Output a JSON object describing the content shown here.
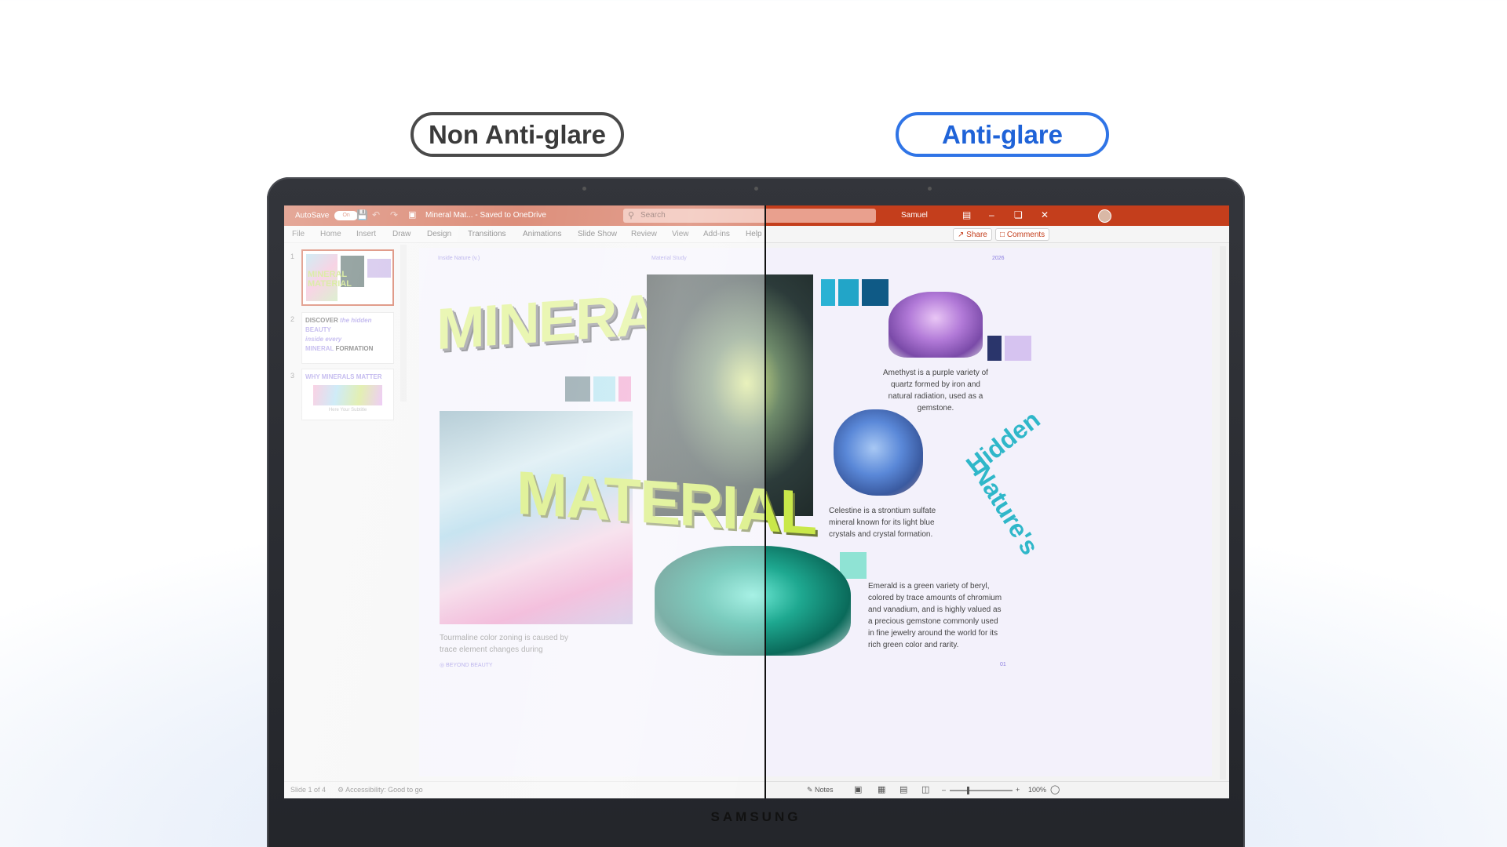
{
  "comparison": {
    "left_label": "Non Anti-glare",
    "right_label": "Anti-glare"
  },
  "laptop": {
    "brand": "SAMSUNG"
  },
  "app": {
    "autosave_label": "AutoSave",
    "autosave_state": "On",
    "doc_title": "Mineral Mat... - Saved to OneDrive",
    "search_placeholder": "Search",
    "user_name": "Samuel",
    "menu": [
      "File",
      "Home",
      "Insert",
      "Draw",
      "Design",
      "Transitions",
      "Animations",
      "Slide Show",
      "Review",
      "View",
      "Add-ins",
      "Help"
    ],
    "share_label": "Share",
    "comments_label": "Comments",
    "accent_color": "#c43e1c"
  },
  "thumbnails": [
    {
      "num": "1",
      "text": "MINERAL MATERIAL"
    },
    {
      "num": "2",
      "line1": "DISCOVER",
      "line1b": "the hidden",
      "line2": "BEAUTY",
      "line3": "inside every",
      "line4": "MINERAL",
      "line4b": "FORMATION"
    },
    {
      "num": "3",
      "title": "WHY MINERALS MATTER",
      "sub": "Here Your Subtitle"
    }
  ],
  "slide": {
    "header_left": "Inside Nature (v.)",
    "header_center": "Material Study",
    "header_right": "2026",
    "title_top": "MINERAL",
    "title_bottom": "MATERIAL",
    "tourmaline_caption": "Tourmaline color zoning is caused by trace element changes during",
    "footer_left": "◎ BEYOND BEAUTY",
    "amethyst_caption": "Amethyst is a purple variety of quartz formed by iron and natural radiation, used as a gemstone.",
    "celestine_caption": "Celestine is a strontium sulfate mineral known for its light blue crystals and crystal formation.",
    "emerald_caption": "Emerald is a green variety of beryl, colored by trace amounts of chromium and vanadium, and is highly valued as a precious gemstone commonly used in fine jewelry around the world for its rich green color and rarity.",
    "ring_word1": "Hidden",
    "ring_word2": "Nature's",
    "page_number": "01",
    "swatches_left": [
      "#5e7a84",
      "#9fdcec",
      "#ee8fc4"
    ],
    "swatches_top": [
      "#2ab2d4",
      "#22a5c8",
      "#0f5a86"
    ],
    "swatches_amethyst": [
      "#2a356b",
      "#d6c3f0"
    ],
    "swatch_emerald": "#8fe3d4"
  },
  "status": {
    "slide_info": "Slide 1 of 4",
    "accessibility": "Accessibility: Good to go",
    "notes": "Notes",
    "zoom": "100%"
  }
}
